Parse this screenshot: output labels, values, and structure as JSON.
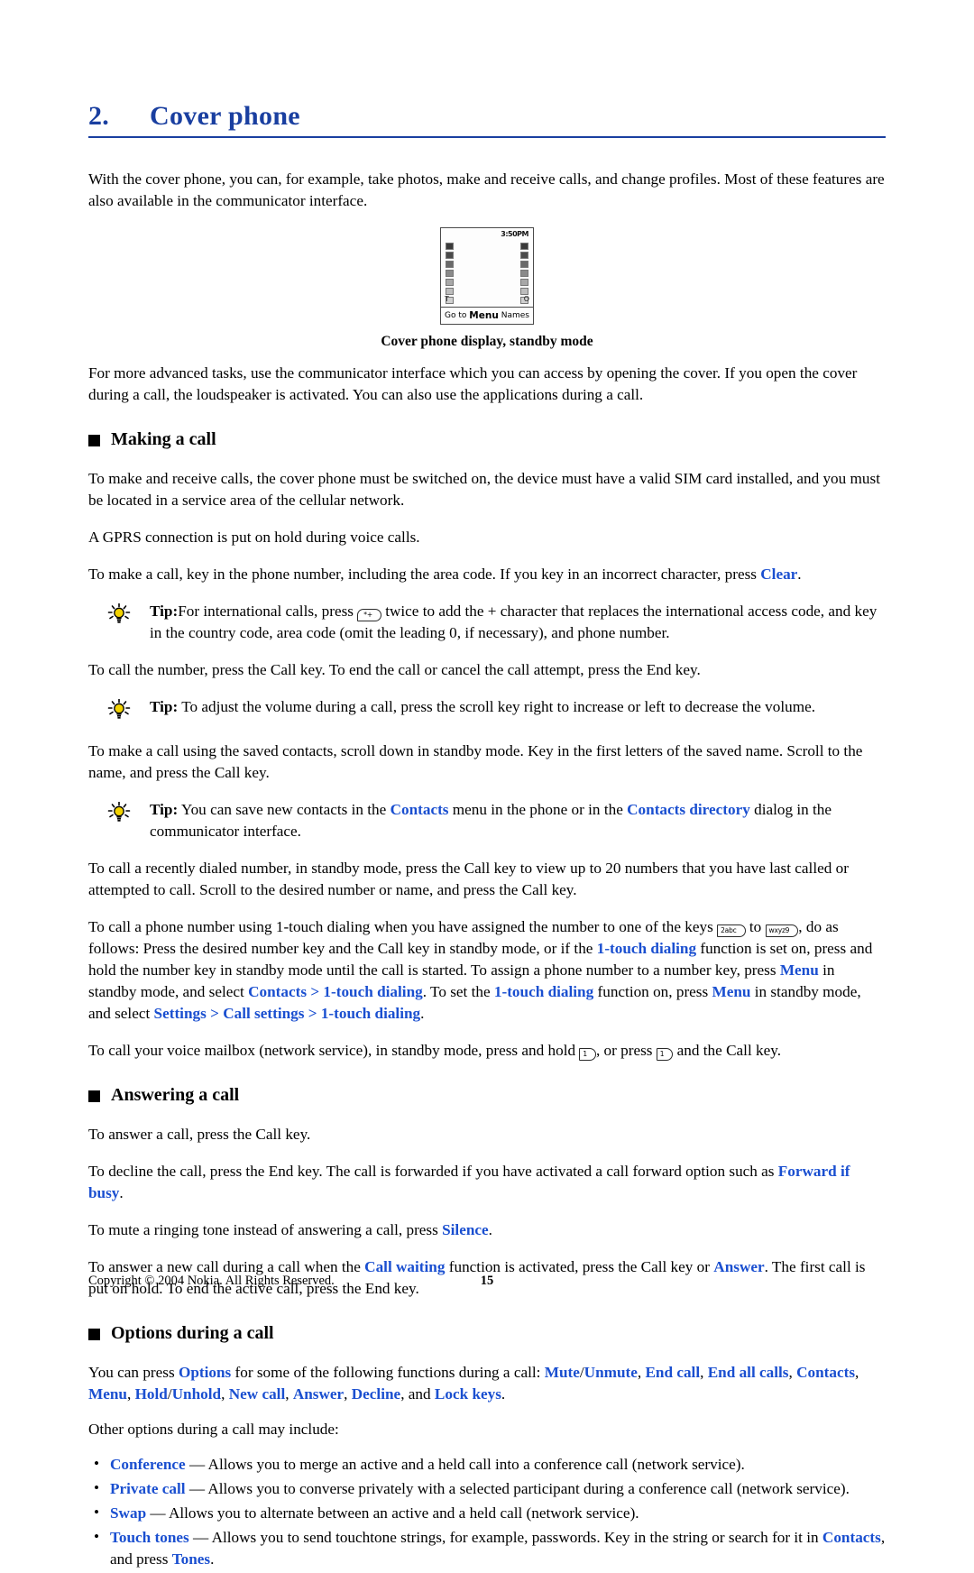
{
  "chapter": {
    "number": "2.",
    "title": "Cover phone"
  },
  "intro": "With the cover phone, you can, for example, take photos, make and receive calls, and change profiles. Most of these features are also available in the communicator interface.",
  "figure": {
    "time": "3:50PM",
    "indicator_left": "T",
    "indicator_right": "O",
    "softkey_left": "Go to",
    "softkey_middle": "Menu",
    "softkey_right": "Names",
    "caption": "Cover phone display, standby mode"
  },
  "para_advanced": "For more advanced tasks, use the communicator interface which you can access by opening the cover. If you open the cover during a call, the loudspeaker is activated. You can also use the applications during a call.",
  "sections": {
    "making_a_call": "Making a call",
    "answering_a_call": "Answering a call",
    "options_during_a_call": "Options during a call"
  },
  "making": {
    "p1": "To make and receive calls, the cover phone must be switched on, the device must have a valid SIM card installed, and you must be located in a service area of the cellular network.",
    "p2": "A GPRS connection is put on hold during voice calls.",
    "p3_a": "To make a call, key in the phone number, including the area code. If you key in an incorrect character, press ",
    "p3_clear": "Clear",
    "p3_b": ".",
    "tip1_label": "Tip:",
    "tip1_a": "For international calls, press ",
    "tip1_key": "*+",
    "tip1_b": " twice to add the + character that replaces the international access code, and key in the country code, area code (omit the leading 0, if necessary), and phone number.",
    "p4": "To call the number, press the Call key. To end the call or cancel the call attempt, press the End key.",
    "tip2_label": "Tip:",
    "tip2_text": "To adjust the volume during a call, press the scroll key right to increase or left to decrease the volume.",
    "p5": "To make a call using the saved contacts, scroll down in standby mode. Key in the first letters of the saved name. Scroll to the name, and press the Call key.",
    "tip3_label": "Tip:",
    "tip3_a": "You can save new contacts in the ",
    "tip3_contacts": "Contacts",
    "tip3_b": " menu in the phone or in the ",
    "tip3_contacts_dir": "Contacts directory",
    "tip3_c": " dialog in the communicator interface.",
    "p6": "To call a recently dialed number, in standby mode, press the Call key to view up to 20 numbers that you have last called or attempted to call. Scroll to the desired number or name, and press the Call key.",
    "p7_a": "To call a phone number using 1-touch dialing when you have assigned the number to one of the keys ",
    "p7_key_from": "2abc",
    "p7_mid": " to ",
    "p7_key_to": "wxyz9",
    "p7_b": ", do as follows: Press the desired number key and the Call key in standby mode, or if the ",
    "p7_onetouch1": "1-touch dialing",
    "p7_c": " function is set on, press and hold the number key in standby mode until the call is started. To assign a phone number to a number key, press ",
    "p7_menu1": "Menu",
    "p7_d": " in standby mode, and select ",
    "p7_contacts": "Contacts",
    "p7_gt1": " > ",
    "p7_onetouch2": "1-touch dialing",
    "p7_e": ". To set the ",
    "p7_onetouch3": "1-touch dialing",
    "p7_f": " function on, press ",
    "p7_menu2": "Menu",
    "p7_g": " in standby mode, and select ",
    "p7_settings": "Settings",
    "p7_gt2": " > ",
    "p7_callsettings": "Call settings",
    "p7_gt3": " > ",
    "p7_onetouch4": "1-touch dialing",
    "p7_h": ".",
    "p8_a": "To call your voice mailbox (network service), in standby mode, press and hold ",
    "p8_key1": "1",
    "p8_b": ", or press ",
    "p8_key2": "1",
    "p8_c": " and the Call key."
  },
  "answering": {
    "p1": "To answer a call, press the Call key.",
    "p2_a": "To decline the call, press the End key. The call is forwarded if you have activated a call forward option such as ",
    "p2_forward": "Forward if busy",
    "p2_b": ".",
    "p3_a": "To mute a ringing tone instead of answering a call, press ",
    "p3_silence": "Silence",
    "p3_b": ".",
    "p4_a": "To answer a new call during a call when the ",
    "p4_callwaiting": "Call waiting",
    "p4_b": " function is activated, press the Call key or ",
    "p4_answer": "Answer",
    "p4_c": ". The first call is put on hold. To end the active call, press the End key."
  },
  "options": {
    "lead_a": "You can press ",
    "lead_options": "Options",
    "lead_b": " for some of the following functions during a call: ",
    "items_inline": [
      "Mute",
      "Unmute",
      "End call",
      "End all calls",
      "Contacts",
      "Menu",
      "Hold",
      "Unhold",
      "New call",
      "Answer",
      "Decline",
      "Lock keys"
    ],
    "lead_c": ".",
    "other_lead": "Other options during a call may include:",
    "bullets": [
      {
        "term": "Conference",
        "text": "Allows you to merge an active and a held call into a conference call (network service)."
      },
      {
        "term": "Private call",
        "text": "Allows you to converse privately with a selected participant during a conference call (network service)."
      },
      {
        "term": "Swap",
        "text": "Allows you to alternate between an active and a held call (network service)."
      }
    ],
    "touch_tones_term": "Touch tones",
    "touch_tones_a": "Allows you to send touchtone strings, for example, passwords. Key in the string or search for it in ",
    "touch_tones_contacts": "Contacts",
    "touch_tones_b": ", and press ",
    "touch_tones_tones": "Tones",
    "touch_tones_c": "."
  },
  "footer": {
    "copyright": "Copyright © 2004 Nokia. All Rights Reserved.",
    "page_number": "15"
  },
  "colors": {
    "heading_blue": "#1a3fa0",
    "link_blue": "#1a4fd0"
  }
}
